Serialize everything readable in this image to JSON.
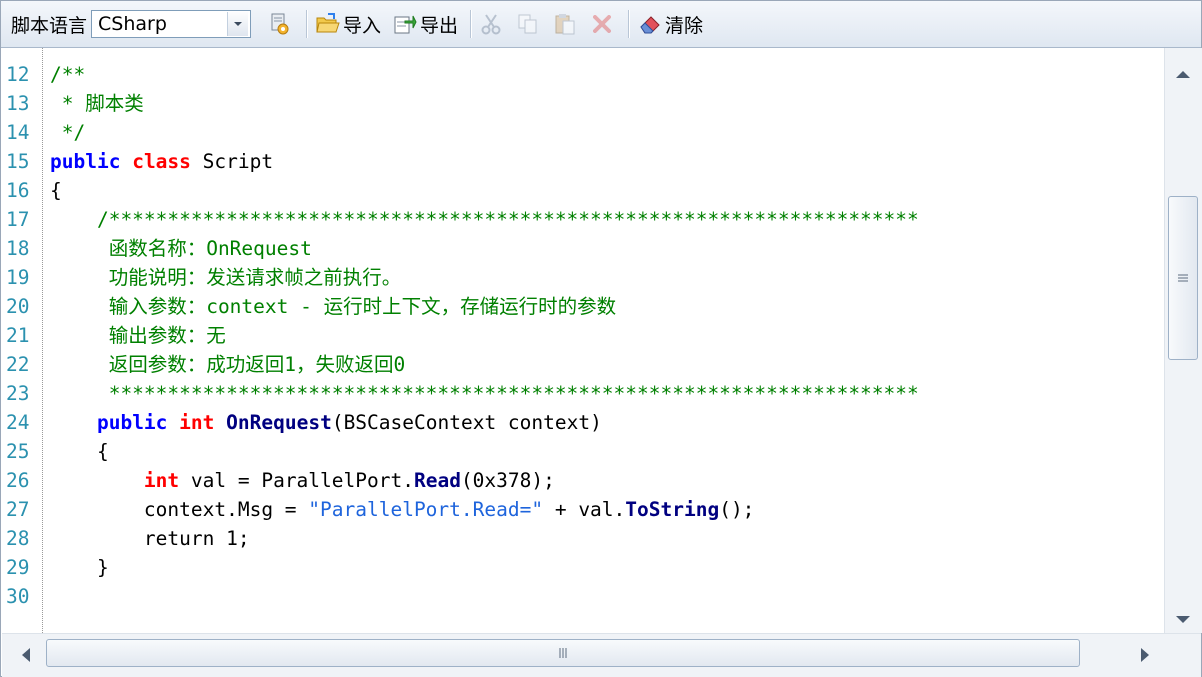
{
  "toolbar": {
    "language_label": "脚本语言",
    "language_value": "CSharp",
    "import_label": "导入",
    "export_label": "导出",
    "clear_label": "清除",
    "icons": [
      "script-settings-icon",
      "folder-open-icon",
      "export-icon",
      "cut-icon",
      "copy-icon",
      "paste-icon",
      "delete-icon",
      "eraser-icon"
    ]
  },
  "editor": {
    "lines": [
      {
        "num": "12",
        "tokens": [
          [
            "cm",
            "/**"
          ]
        ]
      },
      {
        "num": "13",
        "tokens": [
          [
            "cm",
            " * 脚本类"
          ]
        ]
      },
      {
        "num": "14",
        "tokens": [
          [
            "cm",
            " */"
          ]
        ]
      },
      {
        "num": "15",
        "tokens": [
          [
            "kw",
            "public"
          ],
          [
            "tx",
            " "
          ],
          [
            "ty",
            "class"
          ],
          [
            "tx",
            " Script"
          ]
        ]
      },
      {
        "num": "16",
        "tokens": [
          [
            "tx",
            "{"
          ]
        ]
      },
      {
        "num": "17",
        "tokens": [
          [
            "cm",
            "    /*********************************************************************"
          ]
        ]
      },
      {
        "num": "18",
        "tokens": [
          [
            "cm",
            "     函数名称：OnRequest"
          ]
        ]
      },
      {
        "num": "19",
        "tokens": [
          [
            "cm",
            "     功能说明：发送请求帧之前执行。"
          ]
        ]
      },
      {
        "num": "20",
        "tokens": [
          [
            "cm",
            "     输入参数：context - 运行时上下文，存储运行时的参数"
          ]
        ]
      },
      {
        "num": "21",
        "tokens": [
          [
            "cm",
            "     输出参数：无"
          ]
        ]
      },
      {
        "num": "22",
        "tokens": [
          [
            "cm",
            "     返回参数：成功返回1，失败返回0"
          ]
        ]
      },
      {
        "num": "23",
        "tokens": [
          [
            "cm",
            "     *********************************************************************"
          ]
        ]
      },
      {
        "num": "24",
        "tokens": [
          [
            "tx",
            "    "
          ],
          [
            "kw",
            "public"
          ],
          [
            "tx",
            " "
          ],
          [
            "ty",
            "int"
          ],
          [
            "tx",
            " "
          ],
          [
            "fn",
            "OnRequest"
          ],
          [
            "tx",
            "(BSCaseContext context)"
          ]
        ]
      },
      {
        "num": "25",
        "tokens": [
          [
            "tx",
            "    {"
          ]
        ]
      },
      {
        "num": "26",
        "tokens": [
          [
            "tx",
            "        "
          ],
          [
            "ty",
            "int"
          ],
          [
            "tx",
            " val = ParallelPort."
          ],
          [
            "fn",
            "Read"
          ],
          [
            "tx",
            "(0x378);"
          ]
        ]
      },
      {
        "num": "27",
        "tokens": [
          [
            "tx",
            "        context.Msg = "
          ],
          [
            "st",
            "\"ParallelPort.Read=\""
          ],
          [
            "tx",
            " + val."
          ],
          [
            "fn",
            "ToString"
          ],
          [
            "tx",
            "();"
          ]
        ]
      },
      {
        "num": "28",
        "tokens": [
          [
            "tx",
            "        return 1;"
          ]
        ]
      },
      {
        "num": "29",
        "tokens": [
          [
            "tx",
            "    }"
          ]
        ]
      },
      {
        "num": "30",
        "tokens": [
          [
            "tx",
            ""
          ]
        ]
      }
    ]
  },
  "colors": {
    "line_number": "#2b91af",
    "keyword": "#0000ff",
    "type": "#ff0000",
    "comment": "#008000",
    "method": "#000080",
    "string": "#1e64dc"
  }
}
